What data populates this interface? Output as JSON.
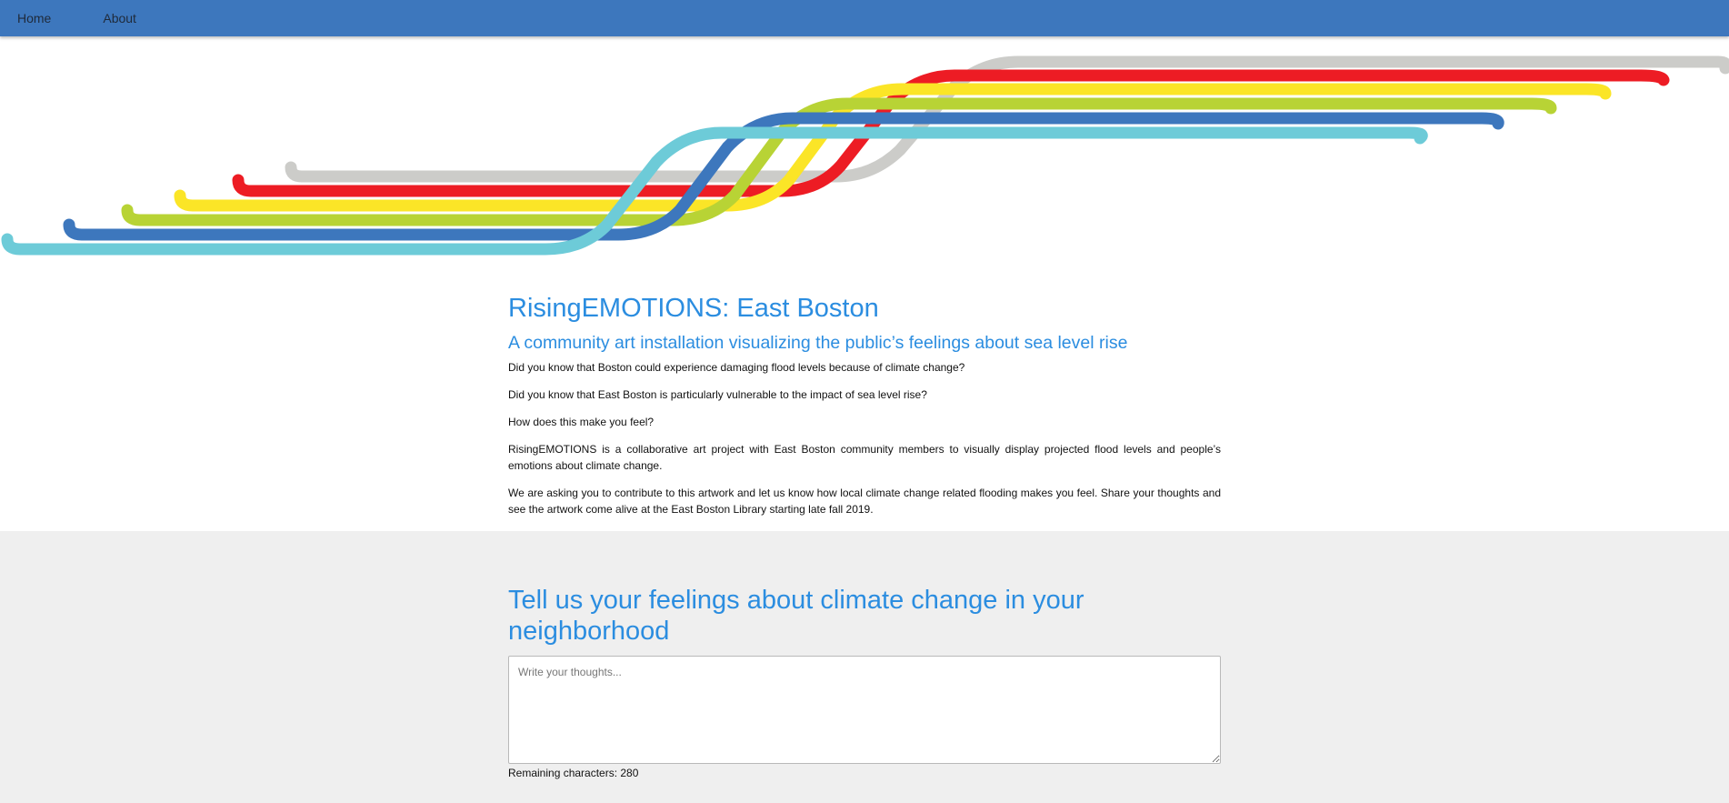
{
  "nav": {
    "items": [
      {
        "label": "Home"
      },
      {
        "label": "About"
      }
    ]
  },
  "hero": {
    "line_colors": [
      "#ccccc9",
      "#ed1c24",
      "#fbe527",
      "#b8d335",
      "#3d77bd",
      "#6dcbd8"
    ]
  },
  "intro": {
    "title": "RisingEMOTIONS: East Boston",
    "subtitle": "A community art installation visualizing the public’s feelings about sea level rise",
    "paragraphs": [
      "Did you know that Boston could experience damaging flood levels because of climate change?",
      "Did you know that East Boston is particularly vulnerable to the impact of sea level rise?",
      "How does this make you feel?",
      "RisingEMOTIONS is a collaborative art project with East Boston community members to visually display projected flood levels and people’s emotions about climate change.",
      "We are asking you to contribute to this artwork and let us know how local climate change related flooding makes you feel. Share your thoughts and see the artwork come alive at the East Boston Library starting late fall 2019."
    ]
  },
  "form": {
    "title": "Tell us your feelings about climate change in your neighborhood",
    "textarea_placeholder": "Write your thoughts...",
    "textarea_value": "",
    "remaining_label": "Remaining characters: 280"
  }
}
